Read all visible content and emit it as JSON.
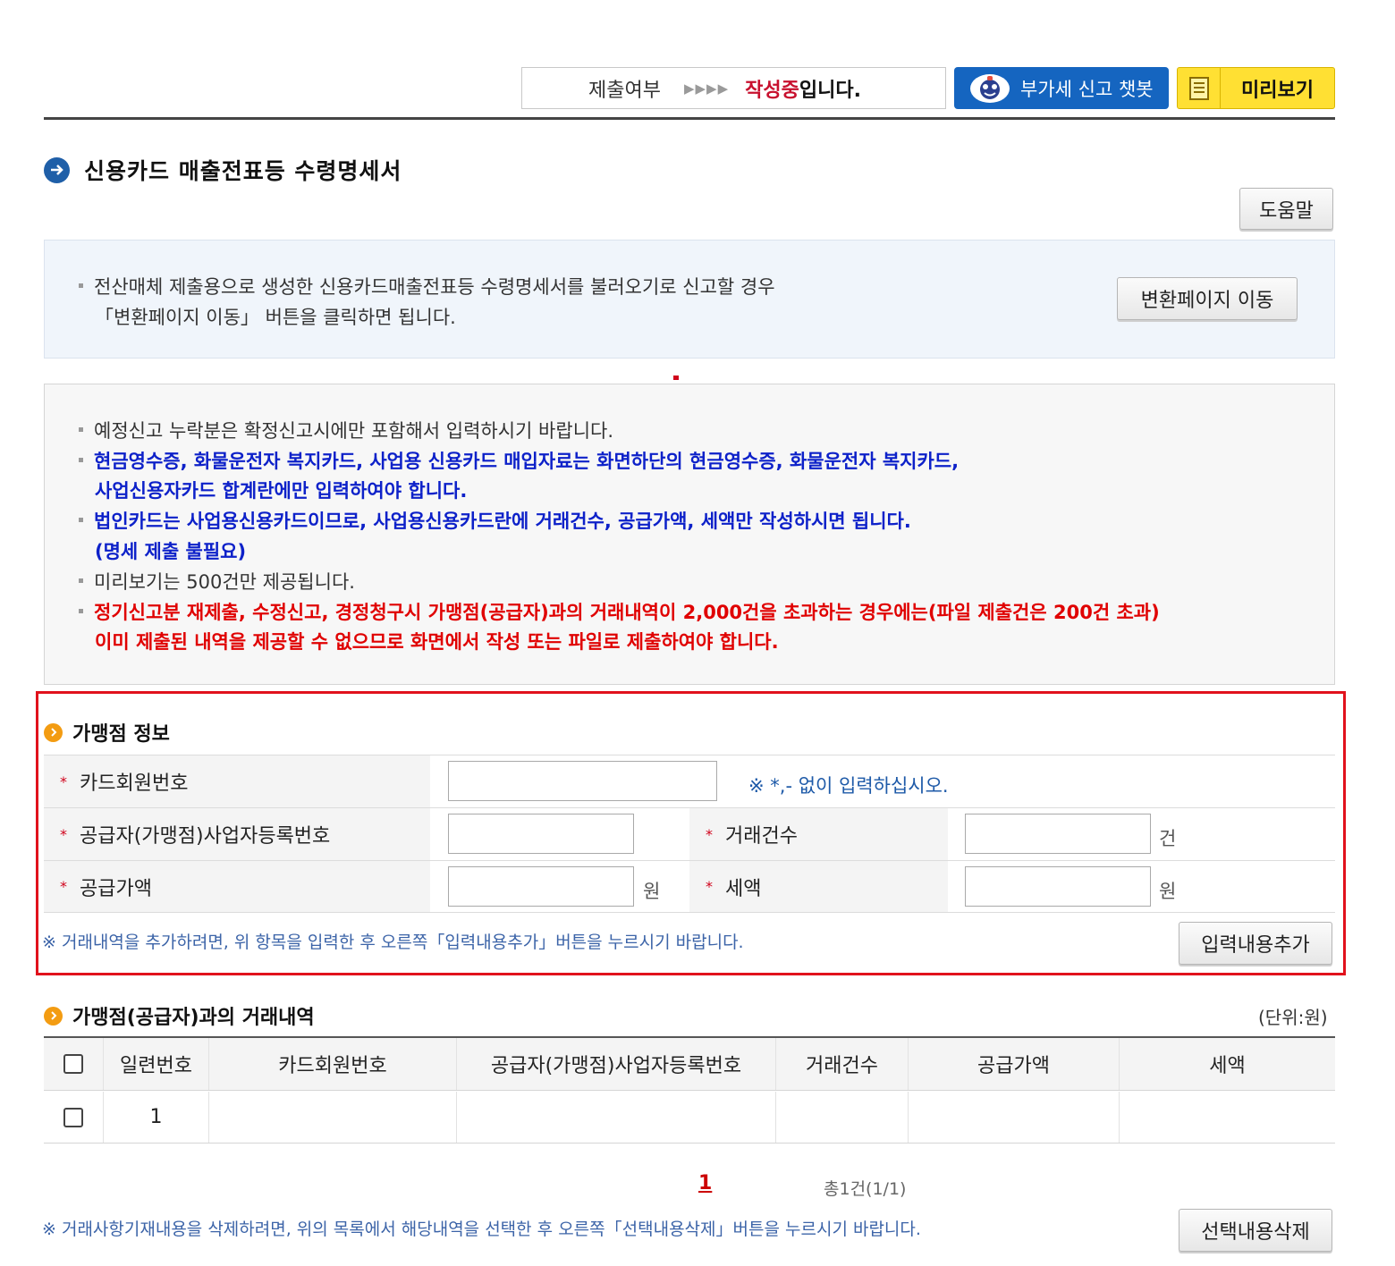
{
  "status": {
    "label": "제출여부",
    "arrows": "▶▶▶▶",
    "state": "작성중",
    "suffix": "입니다."
  },
  "toolbar": {
    "chatbot_label": "부가세 신고 챗봇",
    "preview_label": "미리보기"
  },
  "page_title": "신용카드 매출전표등 수령명세서",
  "help_label": "도움말",
  "info": {
    "line1": "전산매체 제출용으로 생성한 신용카드매출전표등 수령명세서를 불러오기로 신고할 경우",
    "line2": "「변환페이지 이동」 버튼을 클릭하면 됩니다.",
    "convert_button": "변환페이지 이동"
  },
  "notices": {
    "n1": "예정신고 누락분은 확정신고시에만 포함해서 입력하시기 바랍니다.",
    "n2a": "현금영수증, 화물운전자 복지카드, 사업용 신용카드 매입자료는 화면하단의 현금영수증, 화물운전자 복지카드,",
    "n2b": "사업신용자카드 합계란에만 입력하여야 합니다.",
    "n3a": "법인카드는 사업용신용카드이므로, 사업용신용카드란에 거래건수, 공급가액, 세액만 작성하시면 됩니다.",
    "n3b": "(명세 제출 불필요)",
    "n4": "미리보기는 500건만 제공됩니다.",
    "n5a": "정기신고분 재제출, 수정신고, 경정청구시 가맹점(공급자)과의 거래내역이 2,000건을 초과하는 경우에는(파일 제출건은 200건 초과)",
    "n5b": "이미 제출된 내역을 제공할 수 없으므로 화면에서 작성 또는 파일로 제출하여야 합니다."
  },
  "merchant": {
    "heading": "가맹점 정보",
    "card_no_label": "카드회원번호",
    "card_no_value": "",
    "card_no_hint": "※ *,- 없이 입력하십시오.",
    "biz_no_label": "공급자(가맹점)사업자등록번호",
    "biz_no_value": "",
    "count_label": "거래건수",
    "count_value": "",
    "count_unit": "건",
    "supply_label": "공급가액",
    "supply_value": "",
    "supply_unit": "원",
    "tax_label": "세액",
    "tax_value": "",
    "tax_unit": "원",
    "add_note": "※ 거래내역을 추가하려면, 위 항목을 입력한 후 오른쪽「입력내용추가」버튼을 누르시기 바랍니다.",
    "add_button": "입력내용추가",
    "required_mark": "*"
  },
  "transactions": {
    "heading": "가맹점(공급자)과의 거래내역",
    "unit_label": "(단위:원)",
    "columns": [
      "일련번호",
      "카드회원번호",
      "공급자(가맹점)사업자등록번호",
      "거래건수",
      "공급가액",
      "세액"
    ],
    "rows": [
      {
        "seq": "1",
        "card_no": "",
        "biz_no": "",
        "count": "",
        "supply": "",
        "tax": ""
      }
    ],
    "page": "1",
    "total": "총1건(1/1)",
    "delete_note": "※ 거래사항기재내용을 삭제하려면, 위의 목록에서 해당내역을 선택한 후 오른쪽「선택내용삭제」버튼을 누르시기 바랍니다.",
    "delete_button": "선택내용삭제"
  },
  "colors": {
    "accent_blue": "#1565c0",
    "preview_yellow": "#ffe033",
    "highlight_red": "#e1121c"
  }
}
